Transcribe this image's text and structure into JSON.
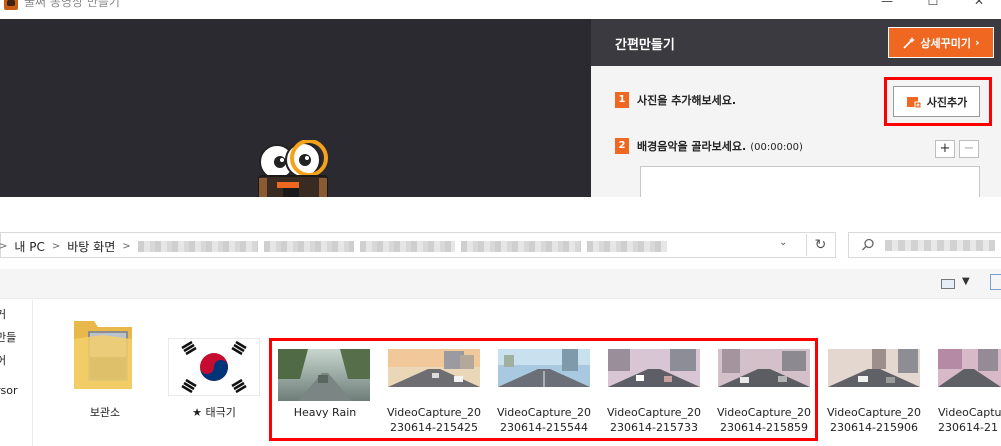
{
  "app_window": {
    "title": "꿀써 동영상 만들기",
    "controls": {
      "minimize": "—",
      "maximize": "☐",
      "close": "✕"
    },
    "panel_title": "간편만들기",
    "detail_button": "상세꾸미기",
    "detail_button_chevron": "›",
    "step1": {
      "number": "1",
      "text": "사진을 추가해보세요.",
      "button": "사진추가"
    },
    "step2": {
      "number": "2",
      "text": "배경음악을 골라보세요.",
      "time": "(00:00:00)",
      "plus": "+",
      "minus": "−"
    },
    "colors": {
      "accent": "#f06722",
      "preview_bg": "#2b2a30",
      "panel_header": "#3a3a40",
      "highlight": "#ff0000"
    }
  },
  "explorer": {
    "breadcrumb": [
      "내 PC",
      "바탕 화면"
    ],
    "refresh": "↻",
    "dropdown": "⌄",
    "sidebar_items": [
      "거",
      "만들",
      "어",
      "rsor"
    ],
    "files": [
      {
        "name": "보관소",
        "type": "folder"
      },
      {
        "name": "★ 태극기",
        "type": "image"
      },
      {
        "name": "Heavy Rain",
        "type": "image"
      },
      {
        "name_line1": "VideoCapture_20",
        "name_line2": "230614-215425",
        "type": "image"
      },
      {
        "name_line1": "VideoCapture_20",
        "name_line2": "230614-215544",
        "type": "image"
      },
      {
        "name_line1": "VideoCapture_20",
        "name_line2": "230614-215733",
        "type": "image"
      },
      {
        "name_line1": "VideoCapture_20",
        "name_line2": "230614-215859",
        "type": "image"
      },
      {
        "name_line1": "VideoCapture_20",
        "name_line2": "230614-215906",
        "type": "image"
      },
      {
        "name_line1": "VideoCapture_20",
        "name_line2": "230614-21",
        "type": "image"
      }
    ]
  }
}
